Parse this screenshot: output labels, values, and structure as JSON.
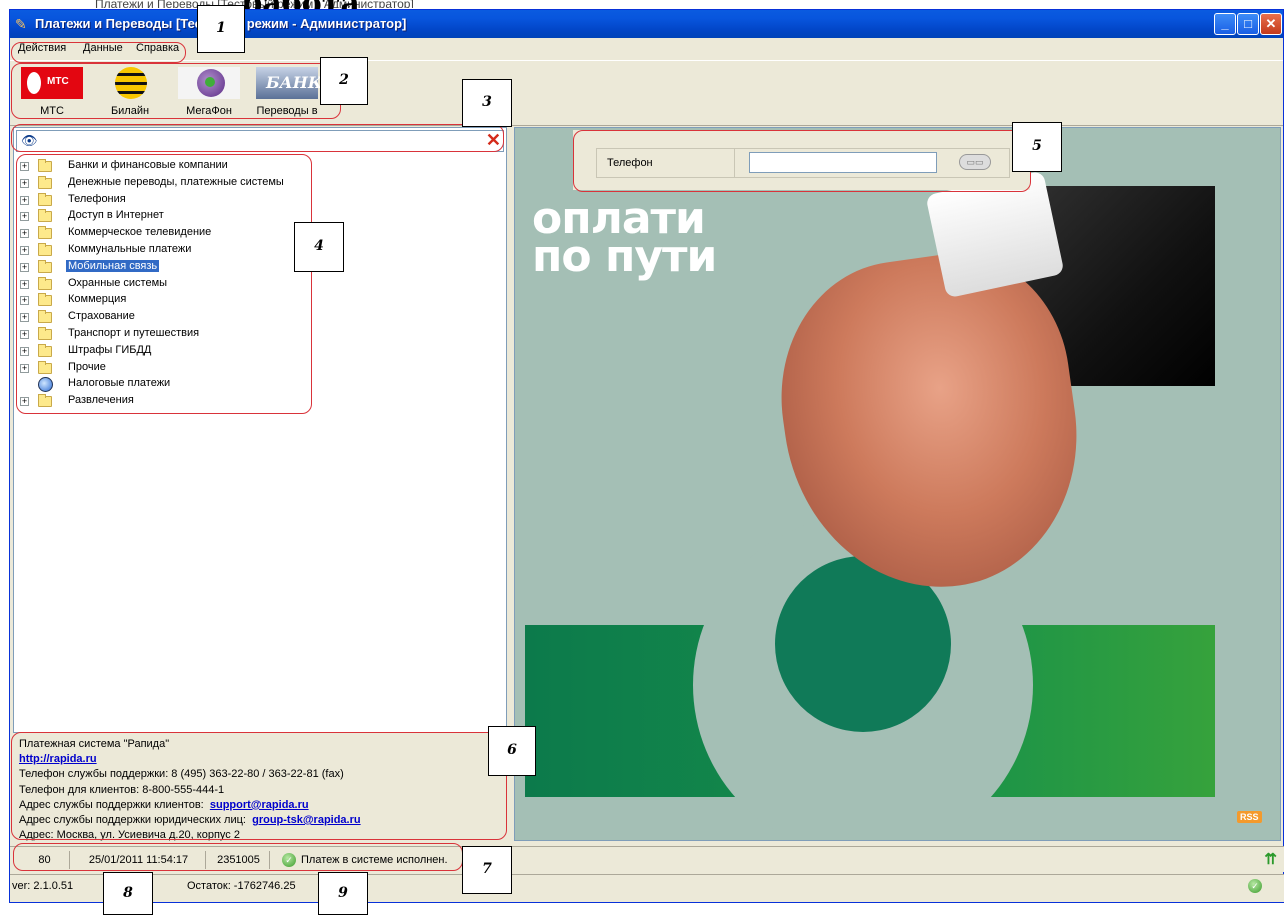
{
  "heading": "...работа",
  "behind_title": "Платежи и Переводы [Тестовый режим - Администратор]",
  "window": {
    "title": "Платежи и Переводы [Тестовый режим - Администратор]"
  },
  "menu": [
    "Действия",
    "Данные",
    "Справка"
  ],
  "toolbar": [
    {
      "label": "МТС",
      "logo": "МТС"
    },
    {
      "label": "Билайн"
    },
    {
      "label": "МегаФон"
    },
    {
      "label": "Переводы в",
      "logo": "БАНК"
    }
  ],
  "search": {
    "value": ""
  },
  "tree": [
    {
      "label": "Банки и финансовые компании",
      "icon": "folder-icon",
      "expandable": true
    },
    {
      "label": "Денежные переводы, платежные системы",
      "icon": "folder-icon",
      "expandable": true
    },
    {
      "label": "Телефония",
      "icon": "folder-icon",
      "expandable": true
    },
    {
      "label": "Доступ в Интернет",
      "icon": "folder-icon",
      "expandable": true
    },
    {
      "label": "Коммерческое телевидение",
      "icon": "folder-icon",
      "expandable": true
    },
    {
      "label": "Коммунальные платежи",
      "icon": "folder-icon",
      "expandable": true
    },
    {
      "label": "Мобильная связь",
      "icon": "folder-icon",
      "expandable": true,
      "selected": true
    },
    {
      "label": "Охранные системы",
      "icon": "folder-icon",
      "expandable": true
    },
    {
      "label": "Коммерция",
      "icon": "folder-icon",
      "expandable": true
    },
    {
      "label": "Страхование",
      "icon": "folder-icon",
      "expandable": true
    },
    {
      "label": "Транспорт и путешествия",
      "icon": "folder-icon",
      "expandable": true
    },
    {
      "label": "Штрафы ГИБДД",
      "icon": "folder-icon",
      "expandable": true
    },
    {
      "label": "Прочие",
      "icon": "folder-icon",
      "expandable": true
    },
    {
      "label": "Налоговые платежи",
      "icon": "globe-icon",
      "expandable": false
    },
    {
      "label": "Развлечения",
      "icon": "folder-icon",
      "expandable": true
    }
  ],
  "info": {
    "system": "Платежная система \"Рапида\"",
    "site": "http://rapida.ru",
    "support_phone": "Телефон службы поддержки: 8 (495) 363-22-80 / 363-22-81 (fax)",
    "client_phone": "Телефон для клиентов: 8-800-555-444-1",
    "client_email_label": "Адрес службы поддержки клиентов:",
    "client_email": "support@rapida.ru",
    "legal_email_label": "Адрес службы поддержки юридических лиц:",
    "legal_email": "group-tsk@rapida.ru",
    "address": "Адрес: Москва, ул. Усиевича д.20, корпус 2"
  },
  "banner": {
    "line1": "оплати",
    "line2": "по пути",
    "rss": "RSS"
  },
  "phone": {
    "label": "Телефон",
    "value": ""
  },
  "status": {
    "count": "80",
    "datetime": "25/01/2011 11:54:17",
    "id": "2351005",
    "message": "Платеж в системе исполнен."
  },
  "status2": {
    "version": "ver: 2.1.0.51",
    "balance": "Остаток: -1762746.25"
  },
  "callouts": [
    "1",
    "2",
    "3",
    "4",
    "5",
    "6",
    "7",
    "8",
    "9"
  ]
}
